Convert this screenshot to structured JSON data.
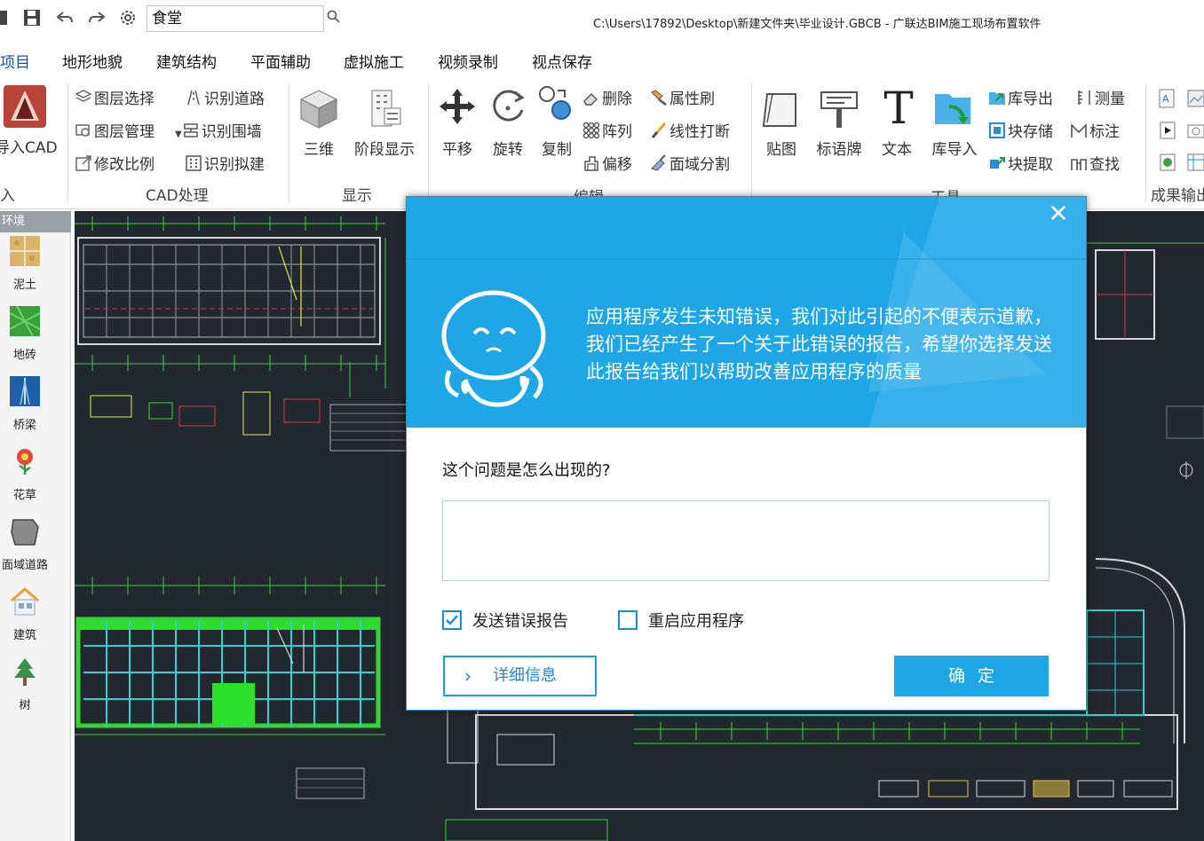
{
  "titlebar": {
    "search_value": "食堂",
    "window_title": "C:\\Users\\17892\\Desktop\\新建文件夹\\毕业设计.GBCB - 广联达BIM施工现场布置软件"
  },
  "menu": {
    "tabs": [
      "项目",
      "地形地貌",
      "建筑结构",
      "平面辅助",
      "虚拟施工",
      "视频录制",
      "视点保存"
    ]
  },
  "ribbon": {
    "import_cad": "导入CAD",
    "import_group": "入",
    "cad": {
      "layer_select": "图层选择",
      "layer_manage": "图层管理",
      "change_scale": "修改比例",
      "identify_road": "识别道路",
      "identify_wall": "识别围墙",
      "identify_proposed": "识别拟建",
      "group": "CAD处理"
    },
    "display": {
      "three_d": "三维",
      "stage_display": "阶段显示",
      "group": "显示"
    },
    "edit": {
      "pan": "平移",
      "rotate": "旋转",
      "copy": "复制",
      "delete": "删除",
      "array": "阵列",
      "offset": "偏移",
      "property_brush": "属性刷",
      "line_break": "线性打断",
      "area_split": "面域分割",
      "group": "编辑"
    },
    "tools": {
      "sticker": "贴图",
      "slogan_board": "标语牌",
      "text": "文本",
      "lib_import": "库导入",
      "lib_export": "库导出",
      "block_store": "块存储",
      "block_extract": "块提取",
      "measure": "测量",
      "annotate": "标注",
      "find": "查找",
      "group": "工具"
    },
    "output": {
      "group": "成果输出"
    }
  },
  "left_panel": {
    "header": "环境",
    "items": [
      "泥土",
      "地砖",
      "桥梁",
      "花草",
      "面域道路",
      "建筑",
      "树"
    ]
  },
  "dialog": {
    "message": "应用程序发生未知错误，我们对此引起的不便表示道歉，我们已经产生了一个关于此错误的报告，希望你选择发送此报告给我们以帮助改善应用程序的质量",
    "question": "这个问题是怎么出现的?",
    "textarea_value": "",
    "send_report_label": "发送错误报告",
    "send_report_checked": true,
    "restart_label": "重启应用程序",
    "restart_checked": false,
    "detail_button": "详细信息",
    "ok_button": "确定"
  }
}
